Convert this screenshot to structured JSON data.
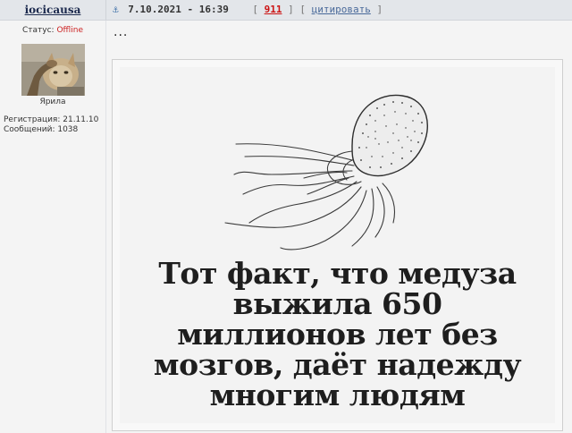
{
  "header": {
    "username": "iocicausa",
    "post_date": "7.10.2021 - 16:39",
    "post_number": "911",
    "quote_label": "цитировать"
  },
  "sidebar": {
    "status_label": "Статус:",
    "status_value": "Offline",
    "avatar_caption": "Ярила",
    "registration": "Регистрация: 21.11.10",
    "messages": "Сообщений: 1038"
  },
  "post": {
    "ellipsis": "...",
    "meme_lines": [
      "Тот факт, что медуза",
      "выжила 650",
      "миллионов лет без",
      "мозгов, даёт надежду",
      "многим людям"
    ]
  },
  "icons": {
    "anchor": "anchor-icon"
  },
  "colors": {
    "header_bg": "#e3e6ea",
    "post_number": "#cc1111",
    "status_offline": "#cc2222",
    "username": "#1c2a4e"
  }
}
